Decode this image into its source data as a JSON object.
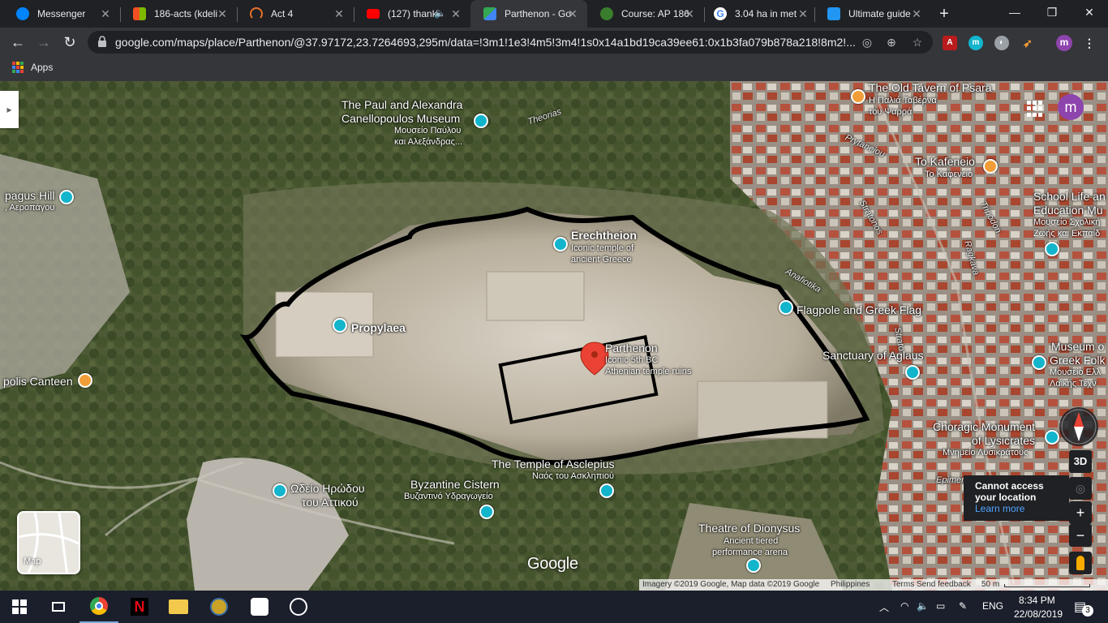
{
  "browser": {
    "tabs": [
      {
        "title": "Messenger",
        "icon": "messenger-icon",
        "color": "#0084ff"
      },
      {
        "title": "186-acts (kdeli",
        "icon": "windows-tiles-icon",
        "color": "#f25022"
      },
      {
        "title": "Act 4",
        "icon": "loader-icon",
        "color": "#e8712b"
      },
      {
        "title": "(127) thank",
        "icon": "youtube-icon",
        "color": "#ff0000"
      },
      {
        "title": "Parthenon - Go",
        "icon": "google-maps-icon",
        "color": "#34a853",
        "active": true
      },
      {
        "title": "Course: AP 186",
        "icon": "course-icon",
        "color": "#3a7d2c"
      },
      {
        "title": "3.04 ha in met",
        "icon": "google-icon",
        "color": "#4285f4"
      },
      {
        "title": "Ultimate guide",
        "icon": "guide-icon",
        "color": "#2196f3"
      }
    ],
    "url": "google.com/maps/place/Parthenon/@37.97172,23.7264693,295m/data=!3m1!1e3!4m5!3m4!1s0x14a1bd19ca39ee61:0x1b3fa079b878a218!8m2!...",
    "bookmarks": {
      "apps_label": "Apps"
    },
    "profile_initial": "m"
  },
  "map": {
    "labels": {
      "paul_museum_en": "The Paul and Alexandra",
      "paul_museum_en2": "Canellopoulos Museum",
      "paul_museum_gr": "Μουσείο Παύλου",
      "paul_museum_gr2": "και Αλεξάνδρας...",
      "theorias": "Theorias",
      "old_tavern_en": "The Old Tavern of Psara",
      "old_tavern_gr": "Η Παλιά Ταβέρνα",
      "old_tavern_gr2": "του Ψαρρά",
      "prytaneiou": "Prytaneiou",
      "kafeneio_en": "To Kafeneio",
      "kafeneio_gr": "Το Καφενείο",
      "areopagus_en": "pagus Hill",
      "areopagus_gr": ", Αεροπάγου",
      "school_life_en": "School Life an",
      "school_life_en2": "Education Mu",
      "school_life_gr": "Μουσείο Σχολική",
      "school_life_gr2": "Ζωής και Εκπαίδ",
      "erechtheion": "Erechtheion",
      "erechtheion_desc": "Iconic temple of",
      "erechtheion_desc2": "ancient Greece",
      "stratonos": "Stratonos",
      "tripodon": "Tripodon",
      "ragkava": "Ragkava",
      "anafiotika": "Anafiotika",
      "flagpole": "Flagpole and Greek Flag",
      "propylaea": "Propylaea",
      "parthenon": "Parthenon",
      "parthenon_desc": "Iconic 5th BC",
      "parthenon_desc2": "Athenian temple ruins",
      "aglaus": "Sanctuary of Aglaus",
      "strato": "Strato",
      "museum_folk_en": "Museum o",
      "museum_folk_en2": "Greek Folk",
      "museum_folk_gr": "Μουσείο Ελλ",
      "museum_folk_gr2": "Λαϊκής Τέχν",
      "canteen": "polis Canteen",
      "choragic_en": "Choragic Monument",
      "choragic_en2": "of Lysicrates",
      "choragic_gr": "Μνημείο Λυσικράτους",
      "asclepius_en": "The Temple of Asclepius",
      "asclepius_gr": "Ναός του Ασκληπιού",
      "byzantine_en": "Byzantine Cistern",
      "byzantine_gr": "Βυζαντινό Υδραγωγείο",
      "odeion_gr": "Ωδείο Ηρώδου",
      "odeion_gr2": "του Αττικού",
      "dionysus": "Theatre of Dionysus",
      "dionysus_desc": "Ancient tiered",
      "dionysus_desc2": "performance arena",
      "epimen": "Epimen"
    },
    "minimap_label": "Map",
    "google_logo": "Google",
    "controls": {
      "three_d": "3D",
      "zoom_in": "+",
      "zoom_out": "−"
    },
    "location_notice": {
      "line1": "Cannot access",
      "line2": "your location",
      "link": "Learn more"
    },
    "footer": {
      "imagery": "Imagery ©2019 Google, Map data ©2019 Google",
      "country": "Philippines",
      "terms": "Terms",
      "feedback": "Send feedback",
      "scale": "50 m"
    }
  },
  "taskbar": {
    "language": "ENG",
    "time": "8:34 PM",
    "date": "22/08/2019",
    "notifications": "3"
  }
}
